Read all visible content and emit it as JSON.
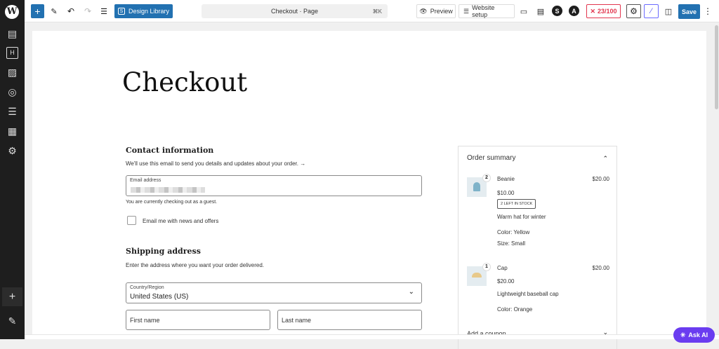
{
  "topbar": {
    "design_library": "Design Library",
    "doc_title": "Checkout · Page",
    "shortcut": "⌘K",
    "preview": "Preview",
    "website_setup": "Website setup",
    "score": "23/100",
    "save": "Save"
  },
  "page": {
    "title": "Checkout"
  },
  "contact": {
    "heading": "Contact information",
    "desc": "We'll use this email to send you details and updates about your order. →",
    "email_label": "Email address",
    "guest_note": "You are currently checking out as a guest.",
    "newsletter": "Email me with news and offers"
  },
  "shipping": {
    "heading": "Shipping address",
    "desc": "Enter the address where you want your order delivered.",
    "country_label": "Country/Region",
    "country_value": "United States (US)",
    "first_name": "First name",
    "last_name": "Last name"
  },
  "summary": {
    "heading": "Order summary",
    "coupon": "Add a coupon",
    "items": [
      {
        "qty": "2",
        "name": "Beanie",
        "total": "$20.00",
        "price": "$10.00",
        "stock": "2 LEFT IN STOCK",
        "desc": "Warm hat for winter",
        "attrs": [
          "Color: Yellow",
          "Size: Small"
        ]
      },
      {
        "qty": "1",
        "name": "Cap",
        "total": "$20.00",
        "price": "$20.00",
        "desc": "Lightweight baseball cap",
        "attrs": [
          "Color: Orange"
        ]
      }
    ]
  },
  "ask_ai": "Ask AI"
}
